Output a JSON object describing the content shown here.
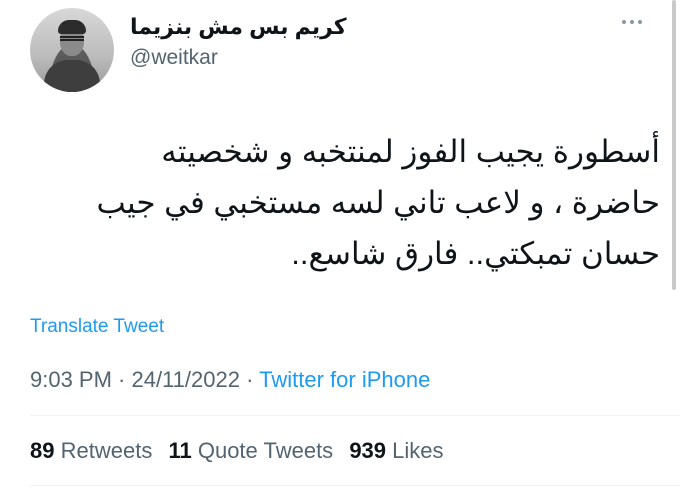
{
  "author": {
    "display_name": "كريم بس مش بنزيما",
    "handle": "@weitkar",
    "avatar_icon": "person-photo"
  },
  "more_icon": "more-horizontal-icon",
  "tweet": {
    "lines": [
      "أسطورة يجيب الفوز لمنتخبه و شخصيته",
      "حاضرة ، و لاعب تاني لسه مستخبي في جيب",
      "حسان تمبكتي.. فارق شاسع.."
    ]
  },
  "translate_label": "Translate Tweet",
  "meta": {
    "time": "9:03 PM",
    "separator": " · ",
    "date": "24/11/2022",
    "source": "Twitter for iPhone"
  },
  "stats": {
    "retweets_count": "89",
    "retweets_label": "Retweets",
    "quotes_count": "11",
    "quotes_label": "Quote Tweets",
    "likes_count": "939",
    "likes_label": "Likes"
  },
  "colors": {
    "accent": "#1d9bf0",
    "secondary_text": "#536471",
    "primary_text": "#0f1419",
    "divider": "#eff3f4"
  }
}
